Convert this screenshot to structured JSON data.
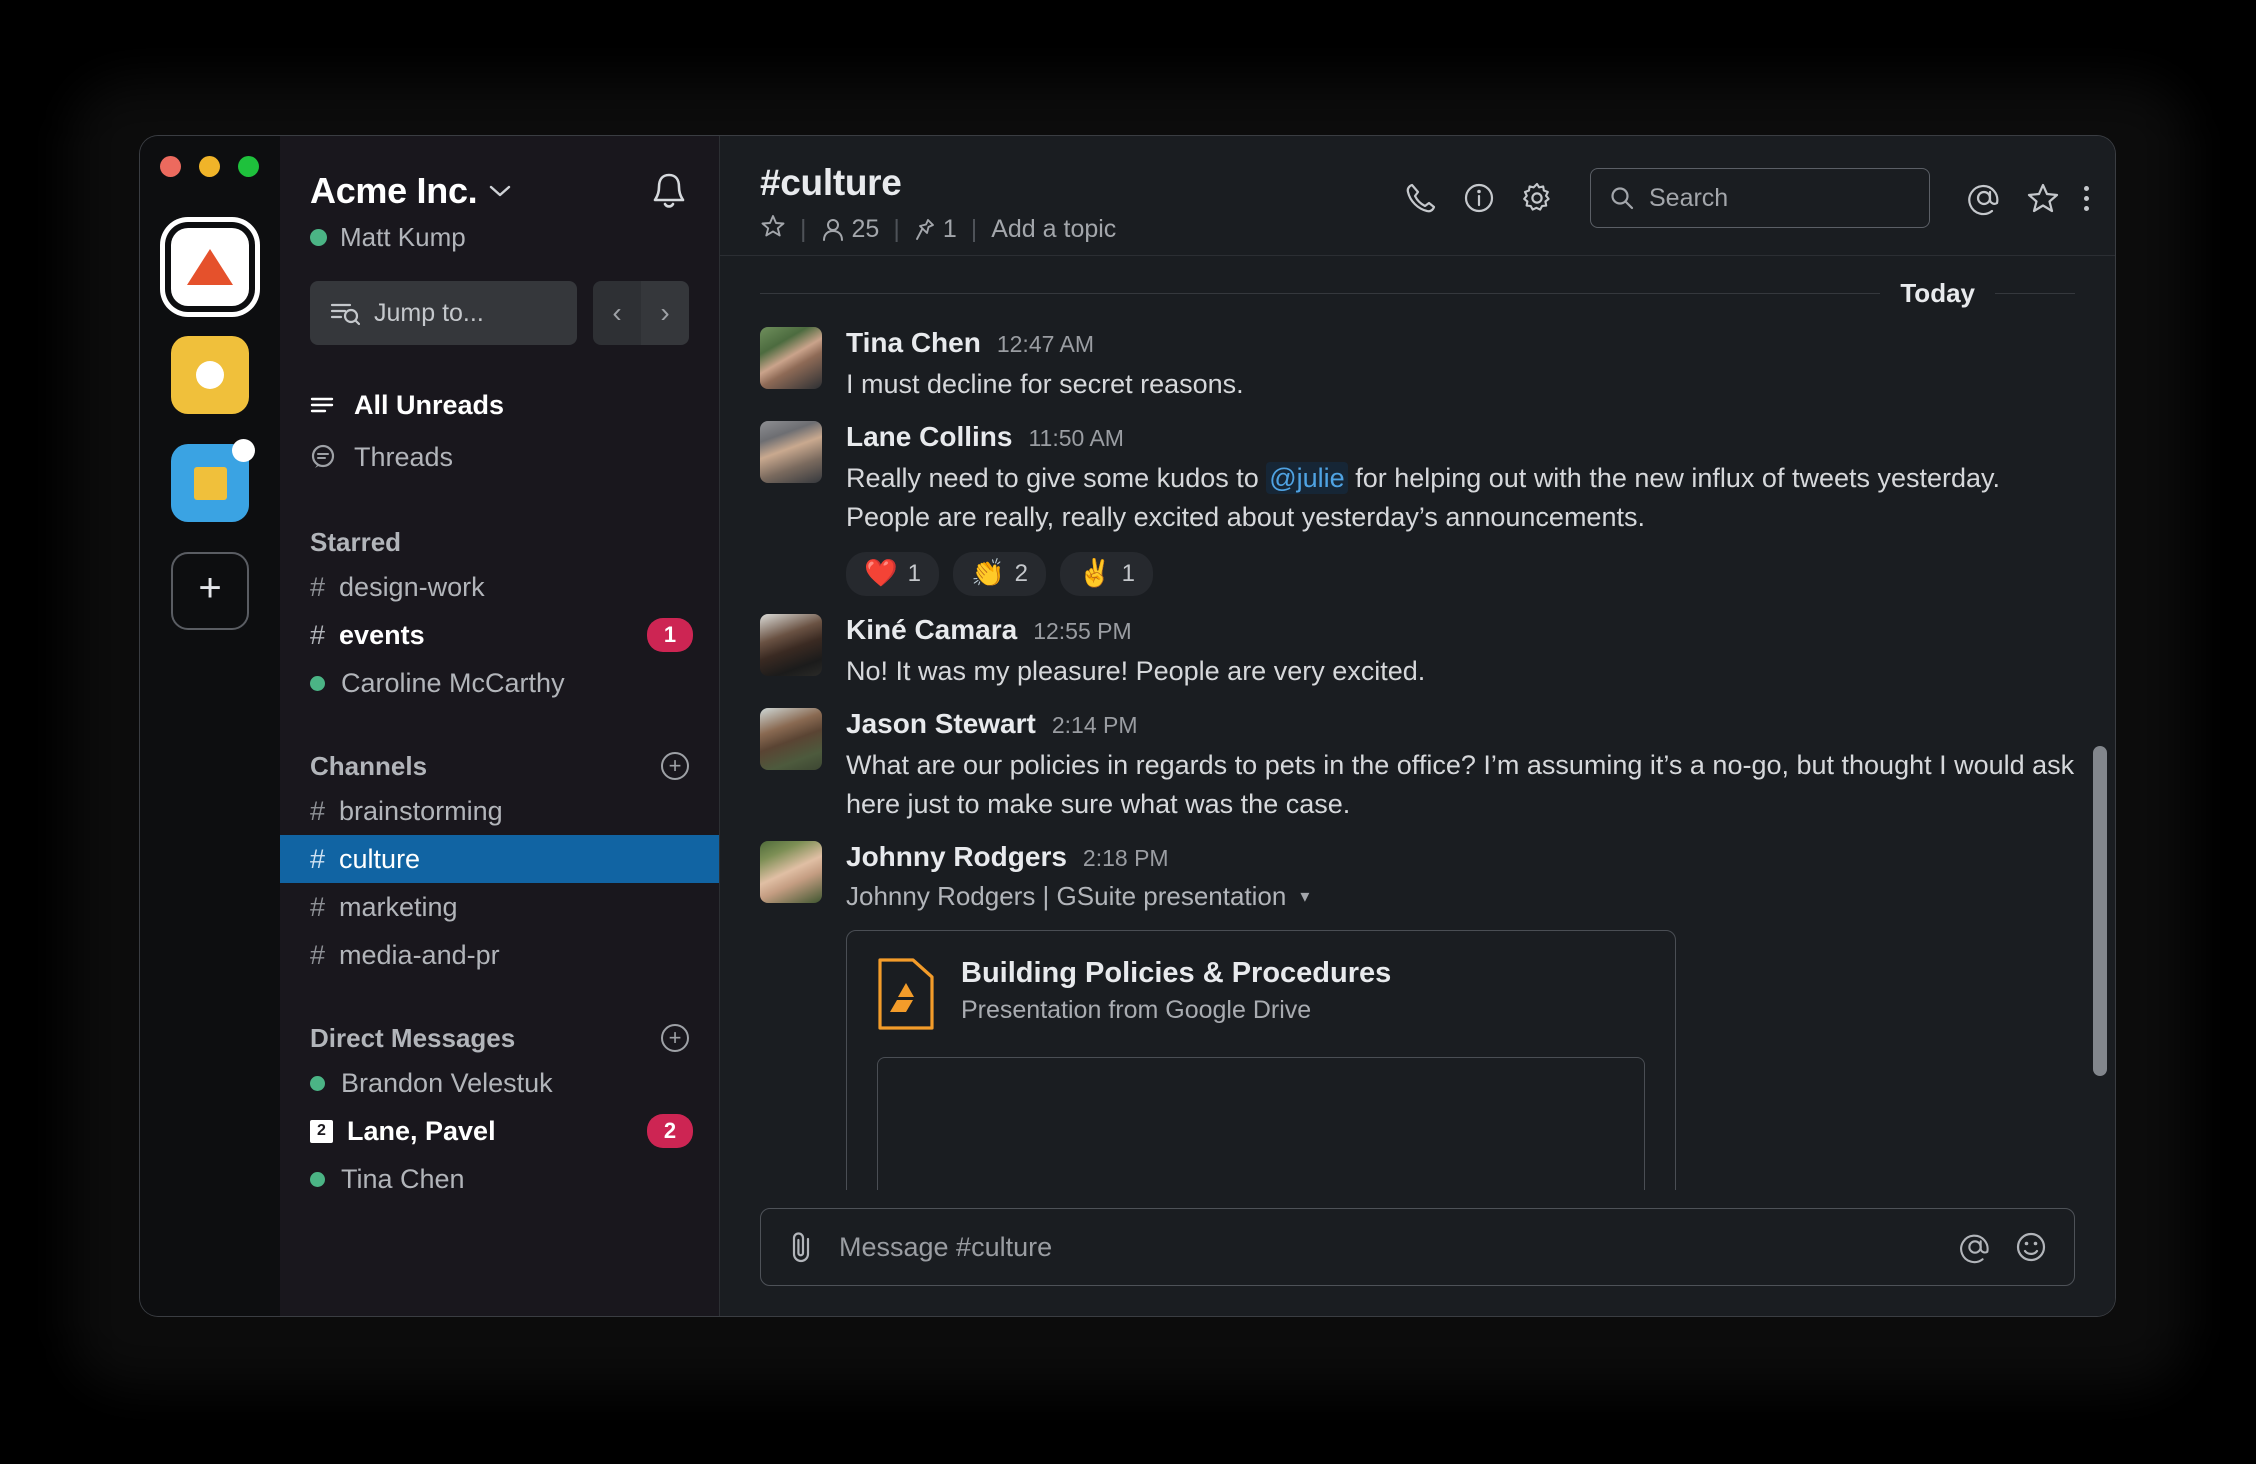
{
  "window": {
    "traffic_lights": [
      "close",
      "minimize",
      "maximize"
    ]
  },
  "rail": {
    "workspaces": [
      {
        "name": "acme-inc-workspace",
        "icon": "triangle-logo",
        "active": true,
        "badge": false
      },
      {
        "name": "yellow-workspace",
        "icon": "circle-logo",
        "active": false,
        "badge": false
      },
      {
        "name": "blue-workspace",
        "icon": "square-logo",
        "active": false,
        "badge": true
      }
    ],
    "add_workspace_label": "+"
  },
  "sidebar": {
    "workspace_name": "Acme Inc.",
    "workspace_chevron": "⌄",
    "user_name": "Matt Kump",
    "user_presence": "active",
    "notifications_icon": "bell-icon",
    "jump_to_placeholder": "Jump to...",
    "nav_back": "‹",
    "nav_forward": "›",
    "nav": [
      {
        "label": "All Unreads",
        "icon": "unreads-icon",
        "bold": true
      },
      {
        "label": "Threads",
        "icon": "threads-icon",
        "bold": false
      }
    ],
    "sections": [
      {
        "title": "Starred",
        "has_add": false,
        "items": [
          {
            "label": "design-work",
            "type": "channel",
            "bold": false,
            "badge": null,
            "selected": false
          },
          {
            "label": "events",
            "type": "channel",
            "bold": true,
            "badge": "1",
            "selected": false
          },
          {
            "label": "Caroline McCarthy",
            "type": "dm",
            "bold": false,
            "badge": null,
            "selected": false
          }
        ]
      },
      {
        "title": "Channels",
        "has_add": true,
        "items": [
          {
            "label": "brainstorming",
            "type": "channel",
            "bold": false,
            "badge": null,
            "selected": false
          },
          {
            "label": "culture",
            "type": "channel",
            "bold": false,
            "badge": null,
            "selected": true
          },
          {
            "label": "marketing",
            "type": "channel",
            "bold": false,
            "badge": null,
            "selected": false
          },
          {
            "label": "media-and-pr",
            "type": "channel",
            "bold": false,
            "badge": null,
            "selected": false
          }
        ]
      },
      {
        "title": "Direct Messages",
        "has_add": true,
        "items": [
          {
            "label": "Brandon Velestuk",
            "type": "dm",
            "bold": false,
            "badge": null,
            "selected": false
          },
          {
            "label": "Lane, Pavel",
            "type": "group",
            "group_count": "2",
            "bold": true,
            "badge": "2",
            "selected": false
          },
          {
            "label": "Tina Chen",
            "type": "dm",
            "bold": false,
            "badge": null,
            "selected": false
          }
        ]
      }
    ]
  },
  "channel_header": {
    "name": "#culture",
    "star_icon": "star-outline-icon",
    "members_icon": "person-icon",
    "member_count": "25",
    "pin_icon": "pin-icon",
    "pin_count": "1",
    "topic_placeholder": "Add a topic",
    "separator": "|",
    "actions": {
      "call_icon": "phone-icon",
      "info_icon": "info-icon",
      "settings_icon": "gear-icon",
      "mentions_icon": "at-icon",
      "starred_icon": "star-outline-icon",
      "more_icon": "kebab-menu-icon"
    },
    "search_placeholder": "Search",
    "search_icon": "search-icon",
    "search_value": ""
  },
  "messages": {
    "day_label": "Today",
    "items": [
      {
        "author": "Tina Chen",
        "time": "12:47 AM",
        "avatar": "av-tina",
        "text_before": "I must decline for secret reasons.",
        "mention": null,
        "text_after": "",
        "reactions": [],
        "attachment": null,
        "bot_subtitle": null
      },
      {
        "author": "Lane Collins",
        "time": "11:50 AM",
        "avatar": "av-lane",
        "text_before": "Really need to give some kudos to ",
        "mention": "@julie",
        "text_after": " for helping out with the new influx of tweets yesterday. People are really, really excited about yesterday’s announcements.",
        "reactions": [
          {
            "emoji": "❤️",
            "name": "heart-reaction",
            "count": "1"
          },
          {
            "emoji": "👏",
            "name": "clap-reaction",
            "count": "2"
          },
          {
            "emoji": "✌️",
            "name": "victory-reaction",
            "count": "1"
          }
        ],
        "attachment": null,
        "bot_subtitle": null
      },
      {
        "author": "Kiné Camara",
        "time": "12:55 PM",
        "avatar": "av-kine",
        "text_before": "No! It was my pleasure! People are very excited.",
        "mention": null,
        "text_after": "",
        "reactions": [],
        "attachment": null,
        "bot_subtitle": null
      },
      {
        "author": "Jason Stewart",
        "time": "2:14 PM",
        "avatar": "av-jason",
        "text_before": "What are our policies in regards to pets in the office? I’m assuming it’s a no-go, but thought I would ask here just to make sure what was the case.",
        "mention": null,
        "text_after": "",
        "reactions": [],
        "attachment": null,
        "bot_subtitle": null
      },
      {
        "author": "Johnny Rodgers",
        "time": "2:18 PM",
        "avatar": "av-john",
        "text_before": "",
        "mention": null,
        "text_after": "",
        "reactions": [],
        "bot_subtitle": "Johnny Rodgers | GSuite presentation",
        "bot_subtitle_caret": "▾",
        "attachment": {
          "icon": "google-drive-file-icon",
          "title": "Building Policies & Procedures",
          "subtitle": "Presentation from Google Drive"
        }
      }
    ]
  },
  "composer": {
    "attach_icon": "paperclip-icon",
    "placeholder": "Message #culture",
    "value": "",
    "mention_icon": "at-icon",
    "emoji_icon": "emoji-smiley-icon"
  },
  "colors": {
    "selected_channel": "#1164a3",
    "badge": "#cd2553",
    "presence_green": "#4bb485",
    "mention_blue": "#4fa3e3",
    "drive_orange": "#f39c2a",
    "logo_red": "#e5512c",
    "logo_yellow": "#f0c03b",
    "logo_blue": "#3aa3e3"
  }
}
